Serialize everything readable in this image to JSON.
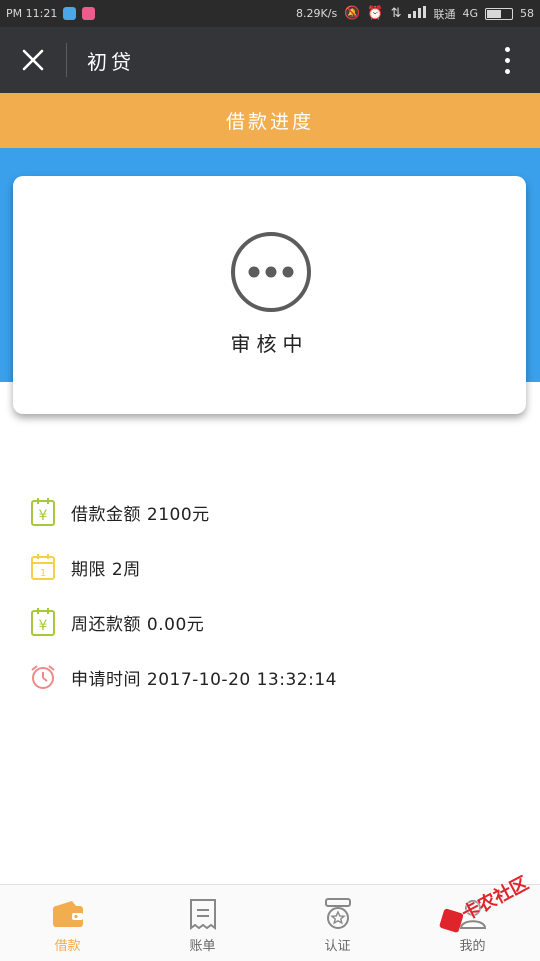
{
  "status_bar": {
    "time": "PM 11:21",
    "net_speed": "8.29K/s",
    "carrier": "联通",
    "network_type": "4G",
    "battery": "58"
  },
  "header": {
    "title": "初贷"
  },
  "banner": {
    "title": "借款进度"
  },
  "status_card": {
    "status": "审核中"
  },
  "details": [
    {
      "icon": "yen-calendar-icon",
      "text": "借款金额 2100元",
      "color": "#a5c93a"
    },
    {
      "icon": "calendar-icon",
      "text": "期限 2周",
      "color": "#f5d04a"
    },
    {
      "icon": "yen-calendar-icon",
      "text": "周还款额 0.00元",
      "color": "#a5c93a"
    },
    {
      "icon": "alarm-clock-icon",
      "text": "申请时间 2017-10-20 13:32:14",
      "color": "#ee8a8a"
    }
  ],
  "bottom_nav": [
    {
      "label": "借款",
      "icon": "wallet-icon",
      "active": true
    },
    {
      "label": "账单",
      "icon": "bill-icon",
      "active": false
    },
    {
      "label": "认证",
      "icon": "badge-icon",
      "active": false
    },
    {
      "label": "我的",
      "icon": "profile-icon",
      "active": false
    }
  ],
  "watermark": {
    "text": "卡农社区"
  },
  "colors": {
    "accent_orange": "#f2ad4e",
    "header_blue": "#3aa0ec",
    "title_bar": "#333538"
  }
}
